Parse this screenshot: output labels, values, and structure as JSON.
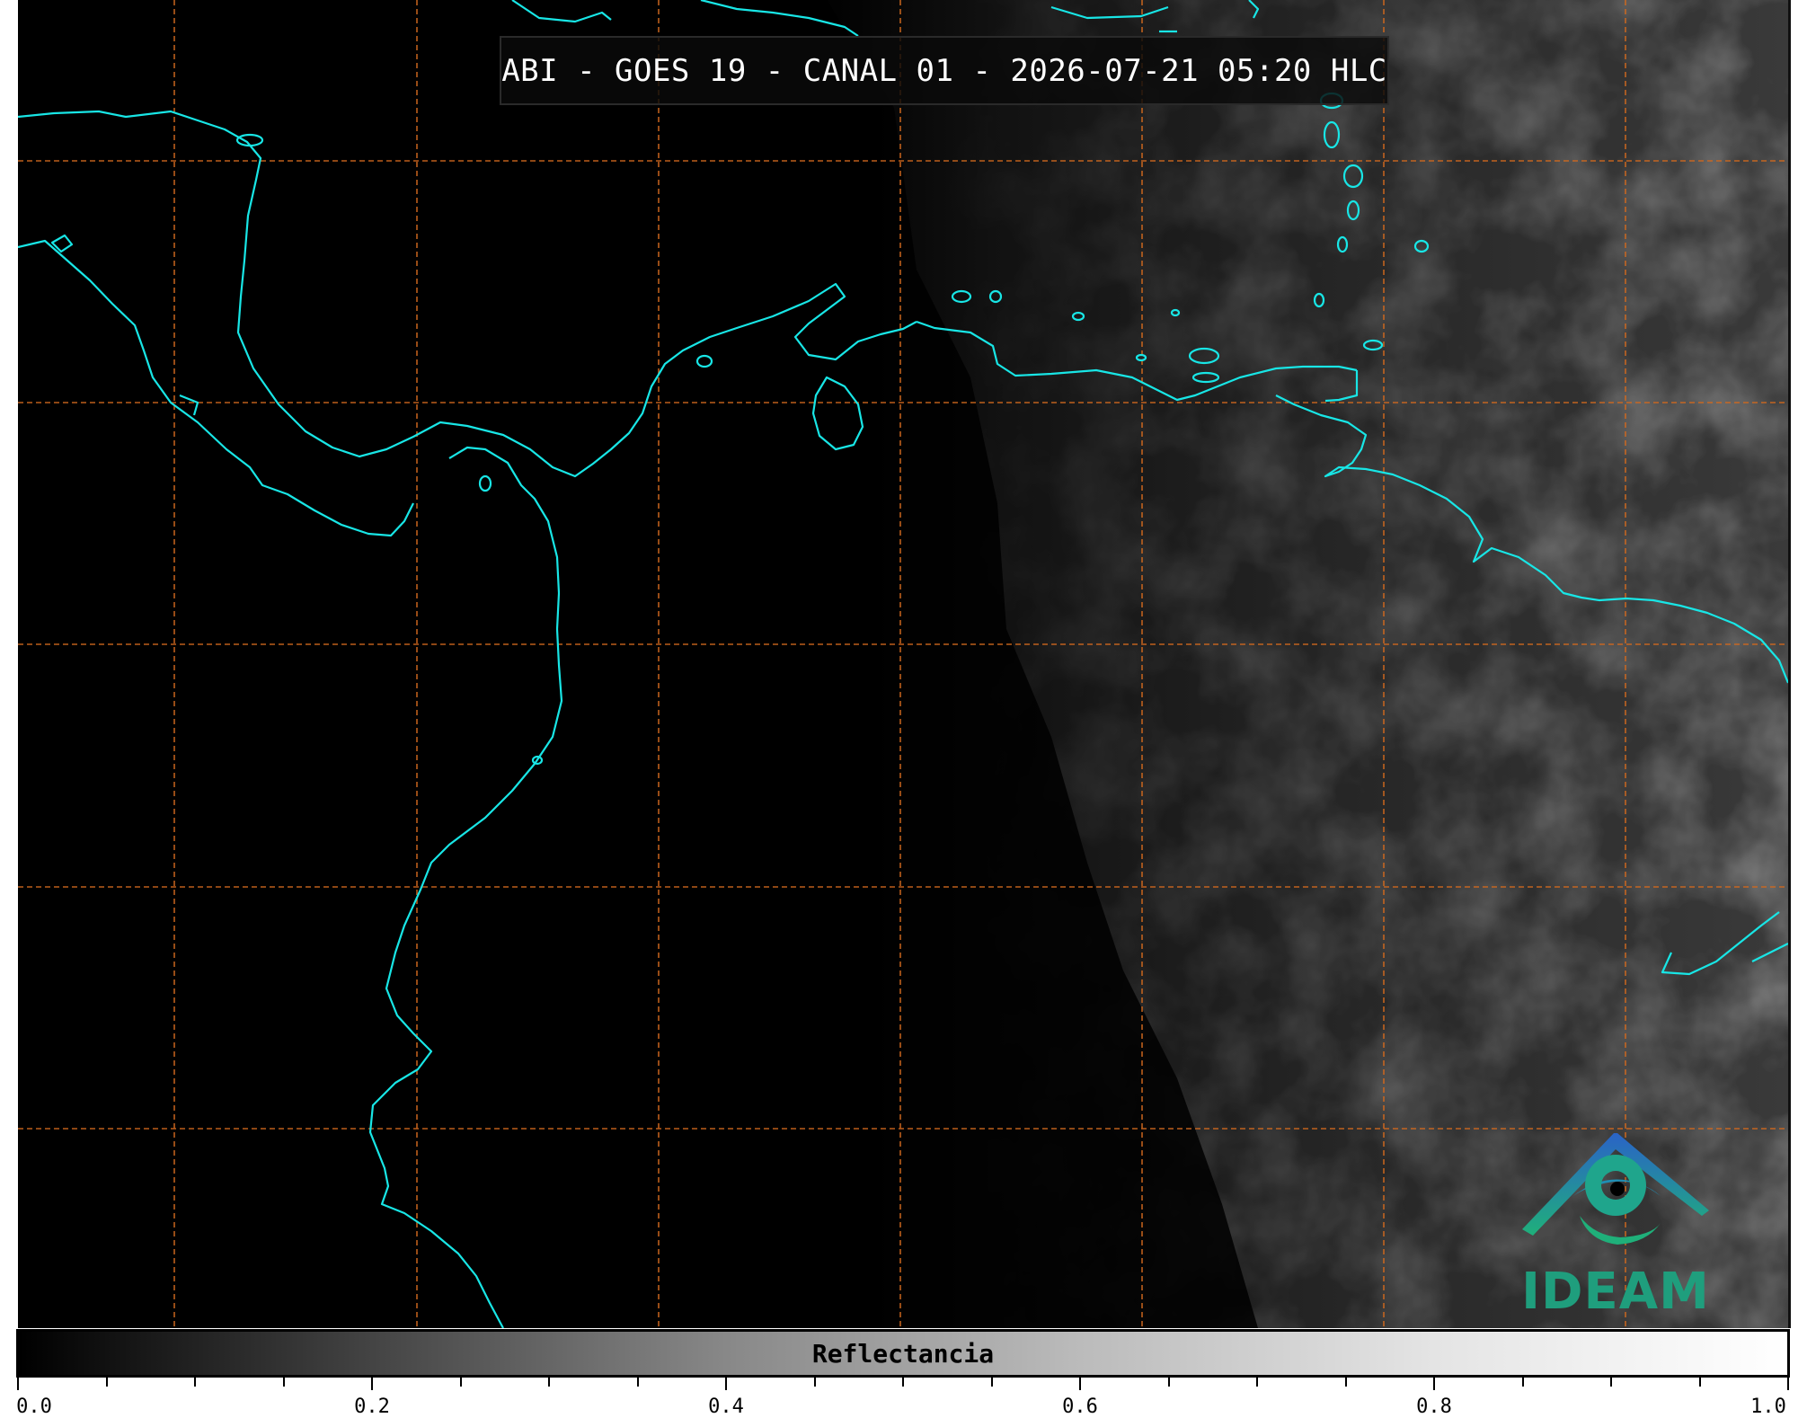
{
  "title": "ABI - GOES 19 - CANAL 01 - 2026-07-21 05:20 HLC",
  "logo": {
    "text": "IDEAM",
    "icon": "ideam-logo-icon"
  },
  "colorbar": {
    "label": "Reflectancia",
    "range": [
      0.0,
      1.0
    ],
    "tick_labels": [
      "0.0",
      "0.2",
      "0.4",
      "0.6",
      "0.8",
      "1.0"
    ],
    "gradient": [
      "#000000",
      "#ffffff"
    ]
  },
  "colors": {
    "coastline": "#18e6e6",
    "gridline": "#d2691e",
    "background": "#000000"
  }
}
